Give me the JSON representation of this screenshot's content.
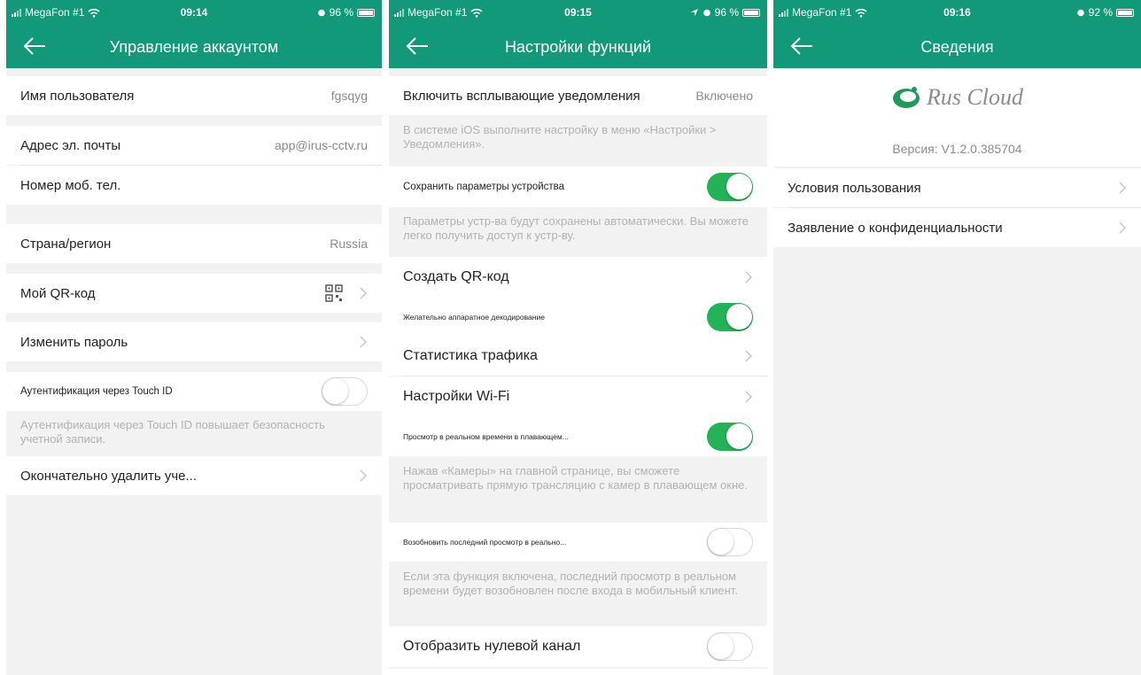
{
  "screens": [
    {
      "status": {
        "carrier": "MegaFon #1",
        "time": "09:14",
        "battery": "96 %"
      },
      "title": "Управление аккаунтом",
      "rows": {
        "username": {
          "label": "Имя пользователя",
          "value": "fgsqyg"
        },
        "email": {
          "label": "Адрес эл. почты",
          "value": "app@irus-cctv.ru"
        },
        "phone": {
          "label": "Номер моб. тел."
        },
        "country": {
          "label": "Страна/регион",
          "value": "Russia"
        },
        "qr": {
          "label": "Мой QR-код"
        },
        "password": {
          "label": "Изменить пароль"
        },
        "touchid": {
          "label": "Аутентификация через Touch ID",
          "state": false,
          "hint": "Аутентификация через Touch ID повышает безопасность учетной записи."
        },
        "delete": {
          "label": "Окончательно удалить уче..."
        }
      }
    },
    {
      "status": {
        "carrier": "MegaFon #1",
        "time": "09:15",
        "battery": "96 %"
      },
      "title": "Настройки функций",
      "rows": {
        "popup": {
          "label": "Включить всплывающие уведомления",
          "value": "Включено",
          "hint": "В системе iOS выполните настройку в меню «Настройки > Уведомления»."
        },
        "save_params": {
          "label": "Сохранить параметры устройства",
          "state": true,
          "hint": "Параметры устр-ва будут сохранены автоматически. Вы можете легко получить доступ к устр-ву."
        },
        "create_qr": {
          "label": "Создать QR-код"
        },
        "hw_decode": {
          "label": "Желательно аппаратное декодирование",
          "state": true
        },
        "traffic": {
          "label": "Статистика трафика"
        },
        "wifi": {
          "label": "Настройки Wi-Fi"
        },
        "floating": {
          "label": "Просмотр в реальном времени в плавающем...",
          "state": true,
          "hint": "Нажав «Камеры» на главной странице, вы сможете просматривать прямую трансляцию с камер в плавающем окне."
        },
        "resume": {
          "label": "Возобновить последний просмотр в реально...",
          "state": false,
          "hint": "Если эта функция включена, последний просмотр в реальном времени будет возобновлен после входа в мобильный клиент."
        },
        "zero_channel": {
          "label": "Отобразить нулевой канал",
          "state": false
        }
      }
    },
    {
      "status": {
        "carrier": "MegaFon #1",
        "time": "09:16",
        "battery": "92 %"
      },
      "title": "Сведения",
      "logo_text": "Rus Cloud",
      "version": "Версия: V1.2.0.385704",
      "rows": {
        "terms": {
          "label": "Условия пользования"
        },
        "privacy": {
          "label": "Заявление о конфиденциальности"
        }
      }
    }
  ],
  "colors": {
    "header": "#11997a",
    "toggle_on": "#22b356",
    "background": "#f2f2f2"
  }
}
